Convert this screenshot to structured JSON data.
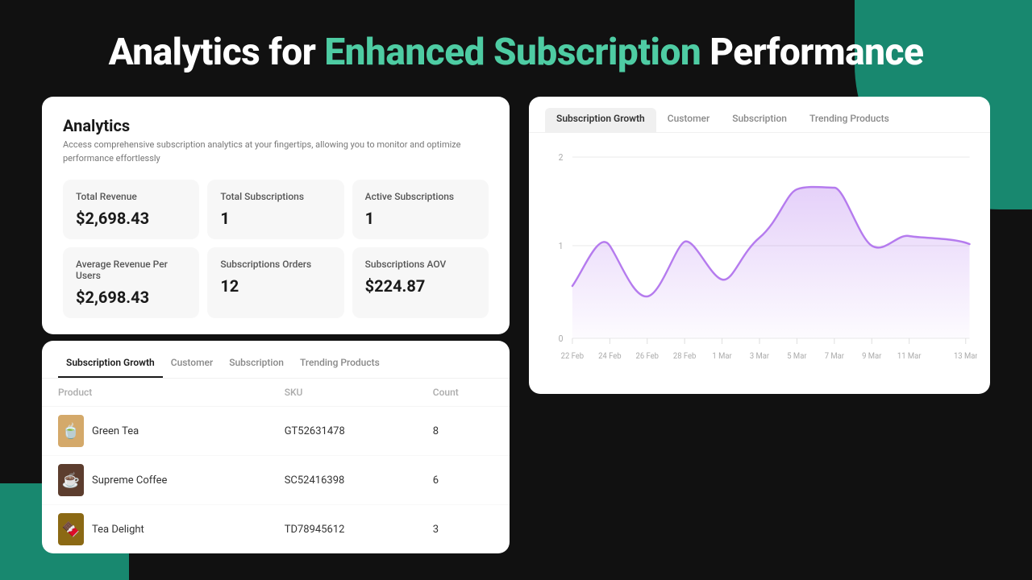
{
  "page": {
    "title_prefix": "Analytics for ",
    "title_accent": "Enhanced Subscription",
    "title_suffix": " Performance"
  },
  "bg_shapes": {
    "teal_top": true,
    "teal_bottom": true
  },
  "analytics": {
    "title": "Analytics",
    "description": "Access comprehensive subscription analytics at your fingertips, allowing you to monitor and optimize performance effortlessly",
    "metrics": [
      {
        "label": "Total Revenue",
        "value": "$2,698.43"
      },
      {
        "label": "Total Subscriptions",
        "value": "1"
      },
      {
        "label": "Active Subscriptions",
        "value": "1"
      },
      {
        "label": "Average Revenue Per Users",
        "value": "$2,698.43"
      },
      {
        "label": "Subscriptions Orders",
        "value": "12"
      },
      {
        "label": "Subscriptions AOV",
        "value": "$224.87"
      }
    ]
  },
  "table": {
    "tabs": [
      {
        "label": "Subscription Growth",
        "active": true
      },
      {
        "label": "Customer",
        "active": false
      },
      {
        "label": "Subscription",
        "active": false
      },
      {
        "label": "Trending Products",
        "active": false
      }
    ],
    "columns": [
      "Product",
      "SKU",
      "Count"
    ],
    "rows": [
      {
        "name": "Green Tea",
        "sku": "GT52631478",
        "count": "8",
        "color": "#d4a96a",
        "emoji": "🍵"
      },
      {
        "name": "Supreme Coffee",
        "sku": "SC52416398",
        "count": "6",
        "color": "#5c3d2e",
        "emoji": "☕"
      },
      {
        "name": "Tea Delight",
        "sku": "TD78945612",
        "count": "3",
        "color": "#8b6914",
        "emoji": "🍫"
      }
    ]
  },
  "chart": {
    "tabs": [
      {
        "label": "Subscription Growth",
        "active": true
      },
      {
        "label": "Customer",
        "active": false
      },
      {
        "label": "Subscription",
        "active": false
      },
      {
        "label": "Trending Products",
        "active": false
      }
    ],
    "y_labels": [
      "2",
      "1",
      "0"
    ],
    "x_labels": [
      "22 Feb",
      "24 Feb",
      "26 Feb",
      "28 Feb",
      "1 Mar",
      "3 Mar",
      "5 Mar",
      "7 Mar",
      "9 Mar",
      "11 Mar",
      "13 Mar"
    ],
    "title": "Subscription Growth"
  },
  "colors": {
    "accent": "#4ecca3",
    "background": "#111111",
    "card_bg": "#ffffff",
    "metric_bg": "#f7f7f7",
    "chart_line": "#b57bee",
    "chart_fill": "rgba(181,123,238,0.18)"
  }
}
